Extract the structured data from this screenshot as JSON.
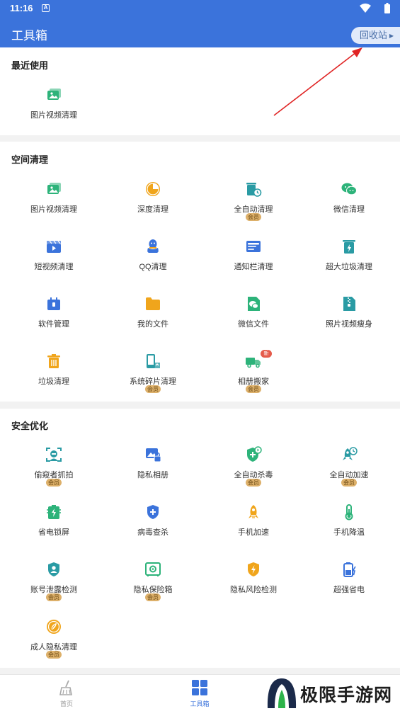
{
  "status_bar": {
    "time": "11:16",
    "notification_glyph": "A"
  },
  "app_bar": {
    "title": "工具箱",
    "recycle_button": "回收站"
  },
  "recent": {
    "title": "最近使用",
    "items": [
      {
        "label": "图片视频清理",
        "icon": "photo-video-icon",
        "color": "#2db37a"
      }
    ]
  },
  "space_clean": {
    "title": "空间清理",
    "items": [
      {
        "label": "图片视频清理",
        "icon": "photo-video-icon",
        "color": "#2db37a"
      },
      {
        "label": "深度清理",
        "icon": "pie-chart-icon",
        "color": "#f0a51c"
      },
      {
        "label": "全自动清理",
        "icon": "trash-clock-icon",
        "color": "#2a9ba4",
        "badge": "会员"
      },
      {
        "label": "微信清理",
        "icon": "wechat-icon",
        "color": "#2db37a"
      },
      {
        "label": "短视频清理",
        "icon": "clapperboard-icon",
        "color": "#3b73db"
      },
      {
        "label": "QQ清理",
        "icon": "qq-penguin-icon",
        "color": "#3b73db"
      },
      {
        "label": "通知栏清理",
        "icon": "notification-icon",
        "color": "#3b73db"
      },
      {
        "label": "超大垃圾清理",
        "icon": "large-trash-icon",
        "color": "#2a9ba4"
      },
      {
        "label": "软件管理",
        "icon": "app-package-icon",
        "color": "#3b73db"
      },
      {
        "label": "我的文件",
        "icon": "folder-icon",
        "color": "#f0a51c"
      },
      {
        "label": "微信文件",
        "icon": "wechat-file-icon",
        "color": "#2db37a"
      },
      {
        "label": "照片视频瘦身",
        "icon": "zip-file-icon",
        "color": "#2a9ba4"
      },
      {
        "label": "垃圾清理",
        "icon": "trash-icon",
        "color": "#f0a51c"
      },
      {
        "label": "系统碎片清理",
        "icon": "phone-fragment-icon",
        "color": "#2a9ba4",
        "badge": "会员"
      },
      {
        "label": "相册搬家",
        "icon": "moving-truck-icon",
        "color": "#2db37a",
        "badge": "会员",
        "new": "新"
      }
    ]
  },
  "security": {
    "title": "安全优化",
    "items": [
      {
        "label": "偷窥者抓拍",
        "icon": "face-scan-icon",
        "color": "#2a9ba4",
        "badge": "会员"
      },
      {
        "label": "隐私相册",
        "icon": "locked-photo-icon",
        "color": "#3b73db"
      },
      {
        "label": "全自动杀毒",
        "icon": "shield-plus-icon",
        "color": "#2db37a",
        "badge": "会员"
      },
      {
        "label": "全自动加速",
        "icon": "rocket-clock-icon",
        "color": "#2a9ba4",
        "badge": "会员"
      },
      {
        "label": "省电锁屏",
        "icon": "battery-lock-icon",
        "color": "#2db37a"
      },
      {
        "label": "病毒查杀",
        "icon": "shield-icon",
        "color": "#3b73db"
      },
      {
        "label": "手机加速",
        "icon": "rocket-icon",
        "color": "#f0a51c"
      },
      {
        "label": "手机降温",
        "icon": "thermometer-icon",
        "color": "#2db37a"
      },
      {
        "label": "账号泄露检测",
        "icon": "user-shield-icon",
        "color": "#2a9ba4",
        "badge": "会员"
      },
      {
        "label": "隐私保险箱",
        "icon": "safe-icon",
        "color": "#2db37a",
        "badge": "会员"
      },
      {
        "label": "隐私风险检测",
        "icon": "lightning-shield-icon",
        "color": "#f0a51c"
      },
      {
        "label": "超强省电",
        "icon": "battery-bolt-icon",
        "color": "#3b73db"
      },
      {
        "label": "成人隐私清理",
        "icon": "leaf-circle-icon",
        "color": "#f0a51c",
        "badge": "会员"
      }
    ]
  },
  "bottom_nav": [
    {
      "label": "首页",
      "icon": "broom-icon",
      "active": false
    },
    {
      "label": "工具箱",
      "icon": "grid-icon",
      "active": true
    }
  ],
  "watermark": {
    "text": "极限手游网"
  }
}
